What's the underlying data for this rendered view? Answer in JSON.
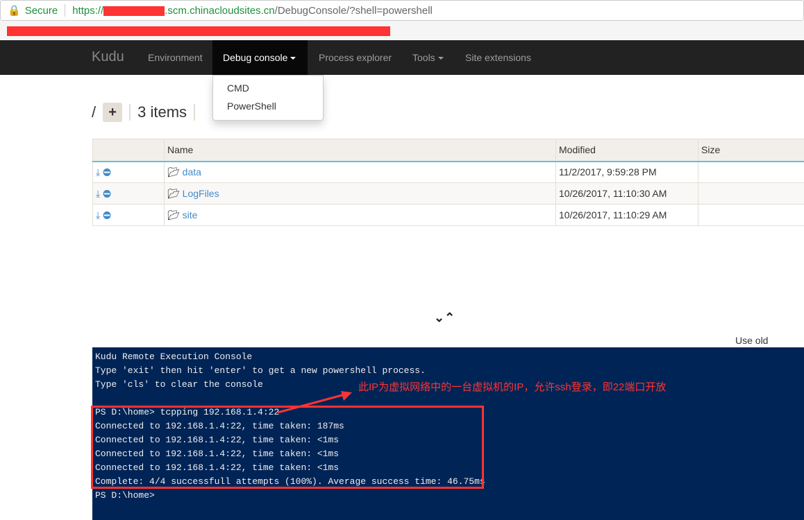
{
  "browser": {
    "secure_label": "Secure",
    "url_prefix": "https://",
    "url_domain": ".scm.chinacloudsites.cn",
    "url_path": "/DebugConsole/?shell=powershell"
  },
  "nav": {
    "logo": "Kudu",
    "items": [
      "Environment",
      "Debug console",
      "Process explorer",
      "Tools",
      "Site extensions"
    ],
    "dropdown": [
      "CMD",
      "PowerShell"
    ]
  },
  "breadcrumb": {
    "root": "/",
    "add": "+",
    "count": "3 items"
  },
  "table": {
    "headers": [
      "Name",
      "Modified",
      "Size"
    ],
    "rows": [
      {
        "name": "data",
        "modified": "11/2/2017, 9:59:28 PM"
      },
      {
        "name": "LogFiles",
        "modified": "10/26/2017, 11:10:30 AM"
      },
      {
        "name": "site",
        "modified": "10/26/2017, 11:10:29 AM"
      }
    ]
  },
  "old_console": "Use old console",
  "console_lines": [
    "Kudu Remote Execution Console",
    "Type 'exit' then hit 'enter' to get a new powershell process.",
    "Type 'cls' to clear the console",
    "",
    "PS D:\\home> tcpping 192.168.1.4:22",
    "Connected to 192.168.1.4:22, time taken: 187ms",
    "Connected to 192.168.1.4:22, time taken: <1ms",
    "Connected to 192.168.1.4:22, time taken: <1ms",
    "Connected to 192.168.1.4:22, time taken: <1ms",
    "Complete: 4/4 successfull attempts (100%). Average success time: 46.75ms",
    "PS D:\\home>"
  ],
  "annotation": "此IP为虚拟网络中的一台虚拟机的IP，允许ssh登录，即22端口开放",
  "colors": {
    "annotation": "#ff3333",
    "console_bg": "#012456"
  }
}
